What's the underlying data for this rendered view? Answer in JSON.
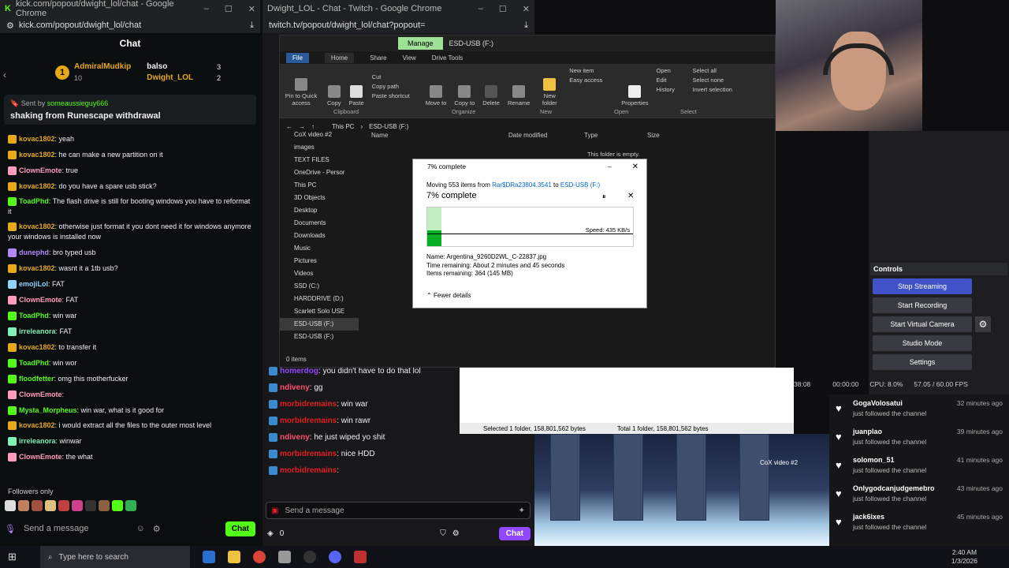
{
  "kick": {
    "title": "kick.com/popout/dwight_lol/chat - Google Chrome",
    "url": "kick.com/popout/dwight_lol/chat",
    "chat_label": "Chat",
    "top": [
      {
        "rank": "1",
        "name": "AdmiralMudkip",
        "count": "10",
        "name2": "balso",
        "count2": "3"
      },
      {
        "name": "Dwight_LOL",
        "count": "2"
      }
    ],
    "pinned": {
      "sent_by": "Sent by",
      "user": "someaussieguy666",
      "message": "shaking from Runescape withdrawal"
    },
    "messages": [
      {
        "user": "kovac1802",
        "color": "#e6a817",
        "text": ": yeah"
      },
      {
        "user": "kovac1802",
        "color": "#e6a817",
        "text": ": he can make a new partition on it"
      },
      {
        "user": "ClownEmote",
        "color": "#ff9bbd",
        "text": ": true"
      },
      {
        "user": "kovac1802",
        "color": "#e6a817",
        "text": ": do you have a spare usb stick?"
      },
      {
        "user": "ToadPhd",
        "color": "#53fc18",
        "text": ": The flash drive is still for booting windows you have to reformat it"
      },
      {
        "user": "kovac1802",
        "color": "#e6a817",
        "text": ": otherwise just format it you dont need it for windows anymore your windows is installed now"
      },
      {
        "user": "dunephd",
        "color": "#b388ff",
        "text": ": bro typed usb"
      },
      {
        "user": "kovac1802",
        "color": "#e6a817",
        "text": ": wasnt it a 1tb usb?"
      },
      {
        "user": "emojiLol",
        "color": "#8fd3ff",
        "text": ": FAT"
      },
      {
        "user": "ClownEmote",
        "color": "#ff9bbd",
        "text": ": FAT"
      },
      {
        "user": "ToadPhd",
        "color": "#53fc18",
        "text": ": win war"
      },
      {
        "user": "irreleanora",
        "color": "#7ef0b8",
        "text": ": FAT"
      },
      {
        "user": "kovac1802",
        "color": "#e6a817",
        "text": ": to transfer it"
      },
      {
        "user": "ToadPhd",
        "color": "#53fc18",
        "text": ": win wor"
      },
      {
        "user": "floodfetter",
        "color": "#53fc18",
        "text": ": omg this motherfucker"
      },
      {
        "user": "ClownEmote",
        "color": "#ff9bbd",
        "text": ":"
      },
      {
        "user": "Mysta_Morpheus",
        "color": "#53fc18",
        "text": ": win war, what is it good for"
      },
      {
        "user": "kovac1802",
        "color": "#e6a817",
        "text": ": i would extract all the files to the outer most level"
      },
      {
        "user": "irreleanora",
        "color": "#7ef0b8",
        "text": ": winwar"
      },
      {
        "user": "ClownEmote",
        "color": "#ff9bbd",
        "text": ": the what"
      }
    ],
    "followers_only": "Followers only",
    "input_placeholder": "Send a message",
    "chat_button": "Chat"
  },
  "twitch": {
    "title": "Dwight_LOL - Chat - Twitch - Google Chrome",
    "url": "twitch.tv/popout/dwight_lol/chat?popout=",
    "messages": [
      {
        "user": "homerdog",
        "color": "#9147ff",
        "text": ": you didn't have to do that lol"
      },
      {
        "user": "ndiveny",
        "color": "#ff4f6b",
        "text": ": gg"
      },
      {
        "user": "morbidremains",
        "color": "#e02020",
        "text": ": win war"
      },
      {
        "user": "morbidremains",
        "color": "#e02020",
        "text": ": win rawr"
      },
      {
        "user": "ndiveny",
        "color": "#ff4f6b",
        "text": ": he just wiped yo shit"
      },
      {
        "user": "morbidremains",
        "color": "#e02020",
        "text": ": nice HDD"
      },
      {
        "user": "morbidremains",
        "color": "#e02020",
        "text": ":"
      }
    ],
    "input_placeholder": "Send a message",
    "points": "0",
    "chat_button": "Chat"
  },
  "explorer": {
    "manage": "Manage",
    "drive": "ESD-USB (F:)",
    "tabs": [
      "File",
      "Home",
      "Share",
      "View",
      "Drive Tools"
    ],
    "ribbon": {
      "pin": "Pin to Quick access",
      "copy": "Copy",
      "paste": "Paste",
      "cut": "Cut",
      "copy_path": "Copy path",
      "paste_shortcut": "Paste shortcut",
      "move_to": "Move to",
      "copy_to": "Copy to",
      "delete": "Delete",
      "rename": "Rename",
      "new_folder": "New folder",
      "new_item": "New item",
      "easy_access": "Easy access",
      "properties": "Properties",
      "open": "Open",
      "edit": "Edit",
      "history": "History",
      "select_all": "Select all",
      "select_none": "Select none",
      "invert": "Invert selection",
      "groups": [
        "Clipboard",
        "Organize",
        "New",
        "Open",
        "Select"
      ]
    },
    "path": [
      "This PC",
      "ESD-USB (F:)"
    ],
    "columns": [
      "Name",
      "Date modified",
      "Type",
      "Size"
    ],
    "empty": "This folder is empty.",
    "sidebar": [
      "CoX video #2",
      "images",
      "TEXT FILES",
      "OneDrive - Persor",
      "This PC",
      "3D Objects",
      "Desktop",
      "Documents",
      "Downloads",
      "Music",
      "Pictures",
      "Videos",
      "SSD (C:)",
      "HARDDRIVE (D:)",
      "Scarlett Solo USE",
      "ESD-USB (F:)",
      "ESD-USB (F:)"
    ],
    "status": "0 items"
  },
  "copy_dialog": {
    "title": "7% complete",
    "moving": "Moving 553 items from",
    "source": "Rar$DRa23804.3541",
    "to": "to",
    "dest": "ESD-USB (F:)",
    "heading": "7% complete",
    "progress": 0.07,
    "speed": "Speed: 435 KB/s",
    "name_label": "Name:",
    "name": "Argentina_9260D2WL_C-22837.jpg",
    "time_label": "Time remaining:",
    "time": "About 2 minutes and 45 seconds",
    "items_label": "Items remaining:",
    "items": "364 (145 MB)",
    "fewer": "Fewer details"
  },
  "explorer2": {
    "selected": "Selected 1 folder, 158,801,562 bytes",
    "total": "Total 1 folder, 158,801,562 bytes"
  },
  "desktop_icon": "CoX video #2",
  "obs": {
    "controls": "Controls",
    "buttons": [
      "Stop Streaming",
      "Start Recording",
      "Start Virtual Camera",
      "Studio Mode",
      "Settings"
    ],
    "rec_time": "38:08",
    "time2": "00:00:00",
    "cpu": "CPU: 8.0%",
    "fps": "57.05 / 60.00 FPS"
  },
  "followers": [
    {
      "name": "GogaVolosatui",
      "action": "just followed the channel",
      "time": "32 minutes ago"
    },
    {
      "name": "juanplao",
      "action": "just followed the channel",
      "time": "39 minutes ago"
    },
    {
      "name": "solomon_51",
      "action": "just followed the channel",
      "time": "41 minutes ago"
    },
    {
      "name": "Onlygodcanjudgemebro",
      "action": "just followed the channel",
      "time": "43 minutes ago"
    },
    {
      "name": "jack6ixes",
      "action": "just followed the channel",
      "time": "45 minutes ago"
    }
  ],
  "taskbar": {
    "search": "Type here to search",
    "time": "2:40 AM",
    "date": "1/3/2026"
  }
}
